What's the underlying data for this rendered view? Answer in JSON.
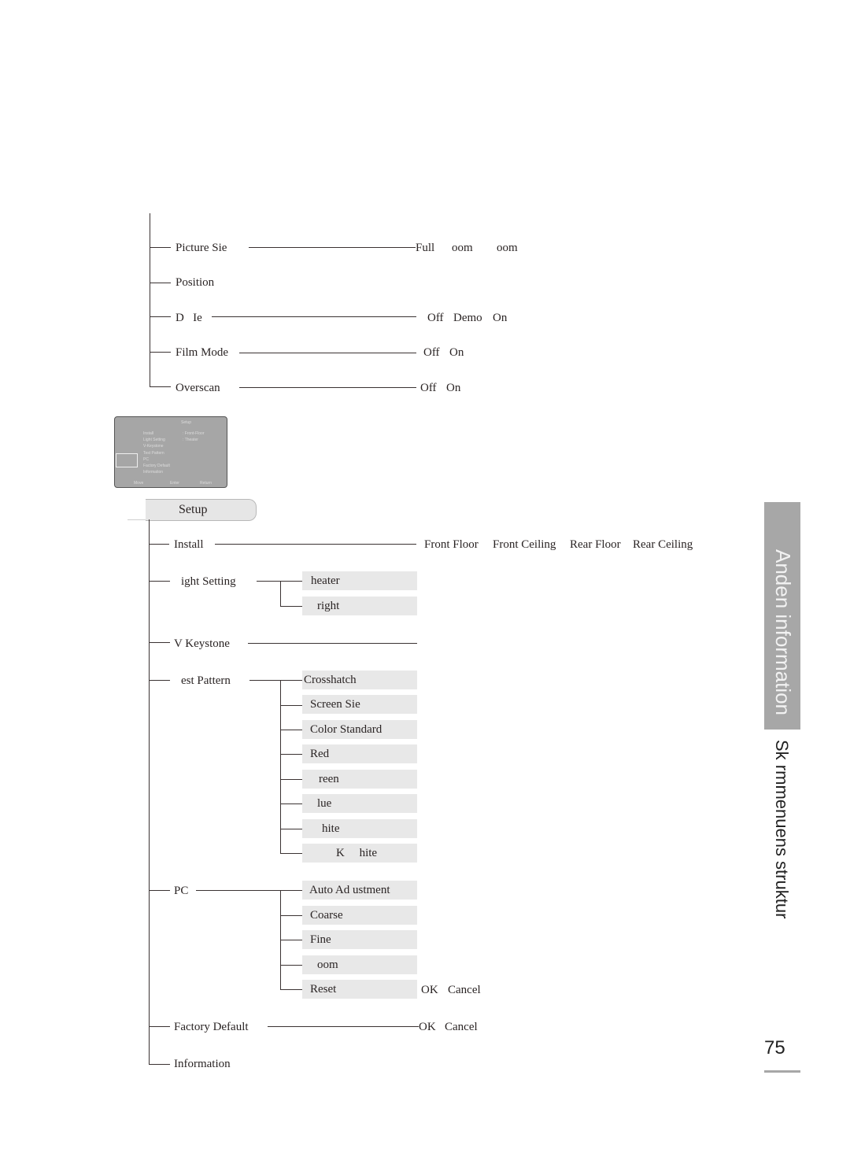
{
  "picture_menu": {
    "items": [
      {
        "label": "Picture Sie",
        "options": [
          "Full",
          "oom",
          "oom"
        ]
      },
      {
        "label": "Position",
        "options": []
      },
      {
        "label": "D   Ie",
        "options": [
          "Off",
          "Demo",
          "On"
        ]
      },
      {
        "label": "Film Mode",
        "options": [
          "Off",
          "On"
        ]
      },
      {
        "label": "Overscan",
        "options": [
          "Off",
          "On"
        ]
      }
    ]
  },
  "osd_preview": {
    "title": "Setup",
    "items": [
      "Install",
      "Light Setting",
      "V-Keystone",
      "Test Pattern",
      "PC",
      "Factory Default",
      "Information"
    ],
    "values": [
      ": Front-Floor",
      ": Theater"
    ],
    "footer": [
      "Move",
      "Enter",
      "Return"
    ]
  },
  "setup_menu": {
    "title": "Setup",
    "install": {
      "label": "Install",
      "options": [
        "Front Floor",
        "Front Ceiling",
        "Rear Floor",
        "Rear Ceiling"
      ]
    },
    "light_setting": {
      "label": "ight Setting",
      "options": [
        "heater",
        "right"
      ]
    },
    "v_keystone": {
      "label": "V Keystone"
    },
    "test_pattern": {
      "label": "est Pattern",
      "options": [
        "Crosshatch",
        "Screen Sie",
        "Color Standard",
        "Red",
        "reen",
        "lue",
        "hite",
        "K     hite"
      ]
    },
    "pc": {
      "label": "PC",
      "options": [
        "Auto Ad ustment",
        "Coarse",
        "Fine",
        "oom",
        "Reset"
      ],
      "reset_options": [
        "OK",
        "Cancel"
      ]
    },
    "factory_default": {
      "label": "Factory Default",
      "options": [
        "OK",
        "Cancel"
      ]
    },
    "information": {
      "label": "Information"
    }
  },
  "side": {
    "section_tab": "Anden information",
    "subtitle": "Sk rmmenuens struktur",
    "page_number": "75"
  }
}
